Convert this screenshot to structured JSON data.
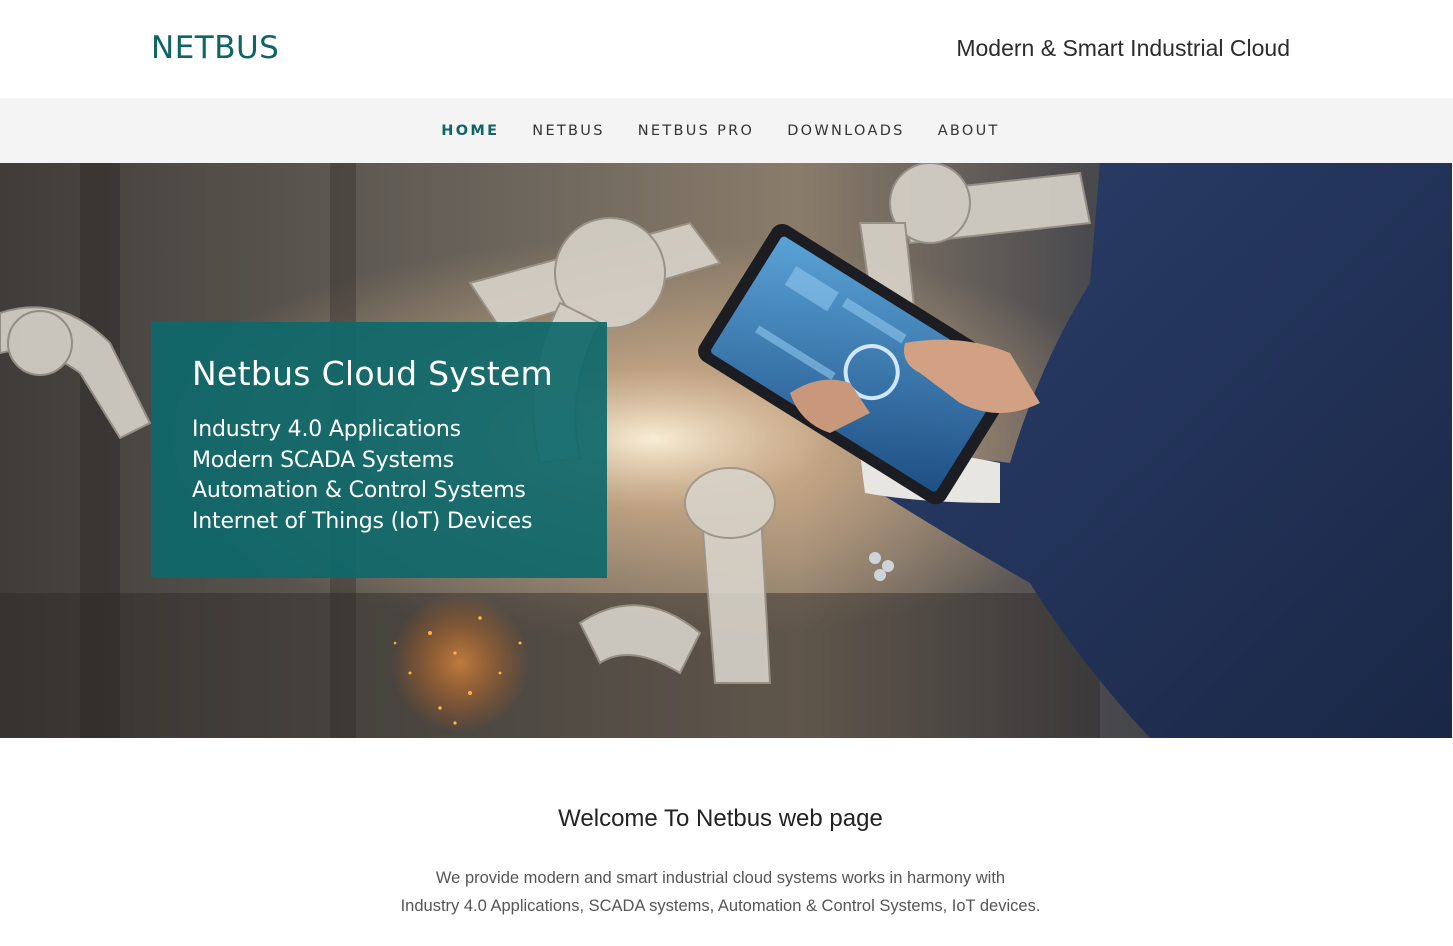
{
  "header": {
    "logo_text": "NETBUS",
    "tagline": "Modern & Smart Industrial Cloud"
  },
  "nav": {
    "items": [
      {
        "label": "HOME",
        "active": true
      },
      {
        "label": "NETBUS",
        "active": false
      },
      {
        "label": "NETBUS PRO",
        "active": false
      },
      {
        "label": "DOWNLOADS",
        "active": false
      },
      {
        "label": "ABOUT",
        "active": false
      }
    ]
  },
  "hero": {
    "title": "Netbus Cloud System",
    "lines": [
      "Industry 4.0 Applications",
      "Modern SCADA Systems",
      "Automation & Control Systems",
      "Internet of Things (IoT) Devices"
    ]
  },
  "welcome": {
    "title": "Welcome To Netbus web page",
    "text_line_1": "We provide modern and smart industrial cloud systems works in harmony with",
    "text_line_2": "Industry 4.0 Applications, SCADA systems, Automation & Control Systems, IoT devices."
  },
  "colors": {
    "brand": "#0f6466",
    "nav_background": "#f4f4f4",
    "hero_card": "#0e686a"
  }
}
